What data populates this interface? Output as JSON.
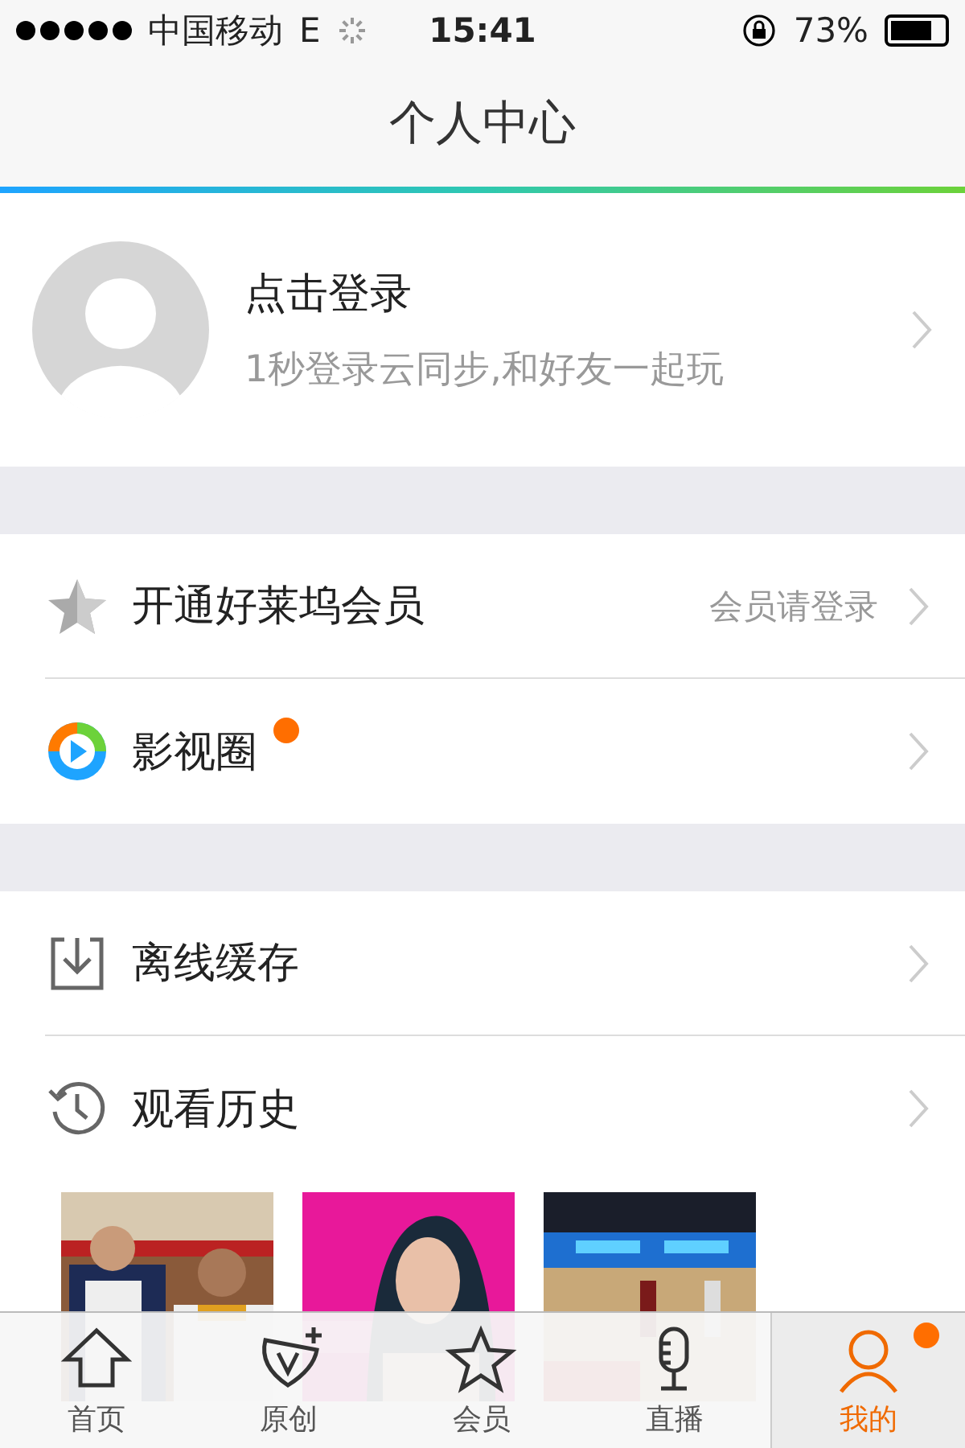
{
  "status_bar": {
    "carrier": "中国移动",
    "network": "E",
    "time": "15:41",
    "battery": "73%"
  },
  "nav_bar": {
    "title": "个人中心"
  },
  "profile": {
    "title": "点击登录",
    "subtitle": "1秒登录云同步,和好友一起玩"
  },
  "menu_groups": [
    [
      {
        "kind": "vip",
        "label": "开通好莱坞会员",
        "detail": "会员请登录",
        "badge": false
      },
      {
        "kind": "circle",
        "label": "影视圈",
        "badge": true
      }
    ],
    [
      {
        "kind": "download",
        "label": "离线缓存",
        "badge": false
      },
      {
        "kind": "history",
        "label": "观看历史",
        "badge": false
      }
    ]
  ],
  "history": [
    {
      "kind": "picture"
    },
    {
      "kind": "picture"
    },
    {
      "kind": "picture"
    }
  ],
  "tab_bar": [
    {
      "kind": "home",
      "label": "首页",
      "selected": false,
      "badge": false
    },
    {
      "kind": "original",
      "label": "原创",
      "selected": false,
      "badge": false
    },
    {
      "kind": "vip",
      "label": "会员",
      "selected": false,
      "badge": false
    },
    {
      "kind": "live",
      "label": "直播",
      "selected": false,
      "badge": false
    },
    {
      "kind": "me",
      "label": "我的",
      "selected": true,
      "badge": true
    }
  ]
}
